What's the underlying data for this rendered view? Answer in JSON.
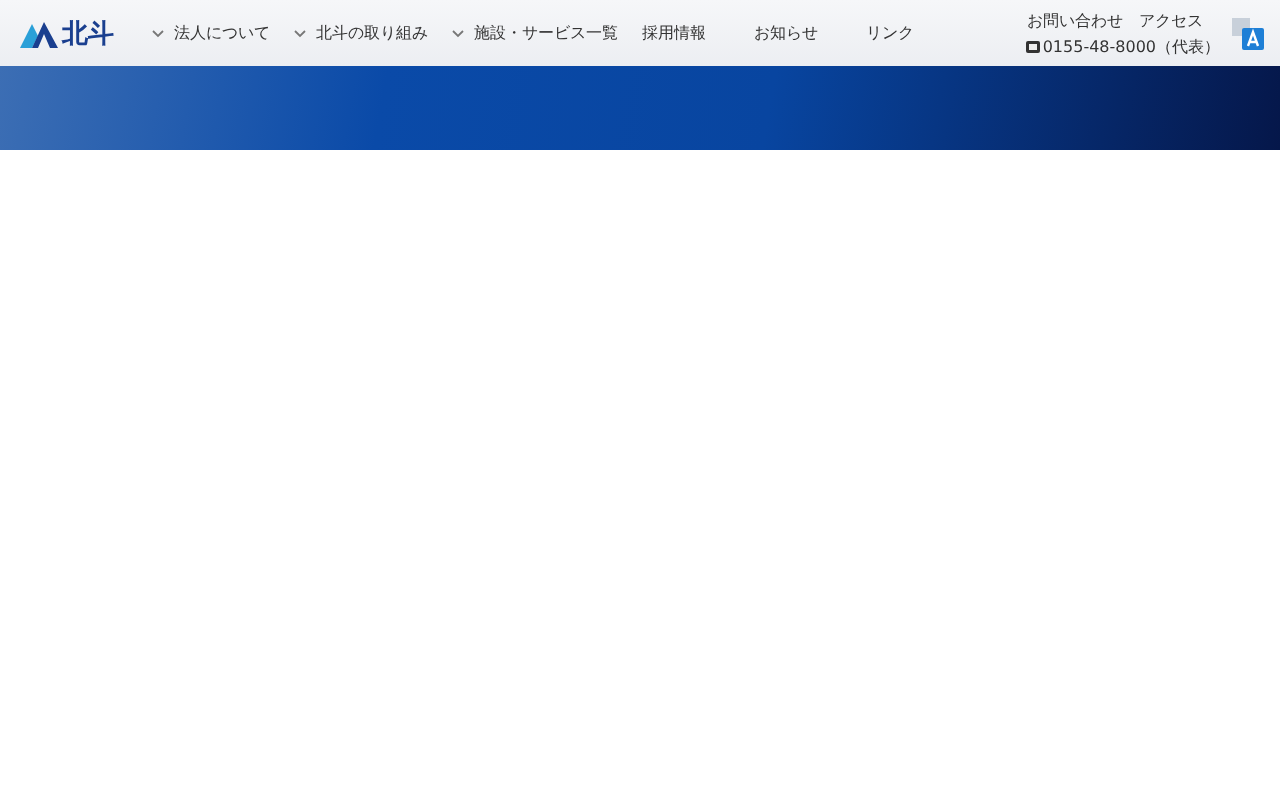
{
  "logo": {
    "name": "北斗"
  },
  "nav": [
    {
      "label": "法人について",
      "dropdown": true
    },
    {
      "label": "北斗の取り組み",
      "dropdown": true
    },
    {
      "label": "施設・サービス一覧",
      "dropdown": true
    },
    {
      "label": "採用情報",
      "dropdown": false
    },
    {
      "label": "お知らせ",
      "dropdown": false
    },
    {
      "label": "リンク",
      "dropdown": false
    }
  ],
  "utility_links": [
    "お問い合わせ",
    "アクセス"
  ],
  "phone": "0155-48-8000（代表）"
}
